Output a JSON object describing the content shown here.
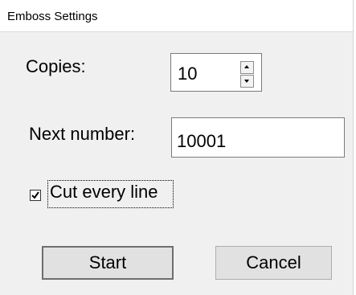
{
  "window": {
    "title": "Emboss Settings"
  },
  "copies": {
    "label": "Copies:",
    "value": "10"
  },
  "next_number": {
    "label": "Next number:",
    "value": "10001"
  },
  "cut_every_line": {
    "label": "Cut every line",
    "checked": true
  },
  "buttons": {
    "start": "Start",
    "cancel": "Cancel"
  },
  "colors": {
    "dialog_bg": "#f0f0f0",
    "titlebar_bg": "#ffffff",
    "button_bg": "#e1e1e1",
    "field_border": "#7a7a7a"
  }
}
